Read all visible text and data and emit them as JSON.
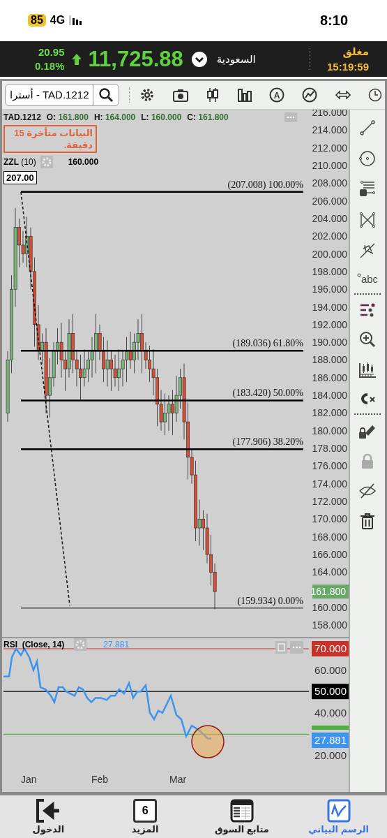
{
  "status_bar": {
    "battery": "85",
    "network": "4G",
    "time": "8:10"
  },
  "ticker": {
    "change": "20.95",
    "change_pct": "0.18%",
    "index_value": "11,725.88",
    "market": "السعودية",
    "market_status": "مغلق",
    "time": "15:19:59"
  },
  "toolbar": {
    "symbol_field": "أسترا - TAD.1212",
    "letter_icon": "A"
  },
  "chart": {
    "symbol": "TAD.1212",
    "ohlc": [
      {
        "label": "O:",
        "value": "161.800"
      },
      {
        "label": "H:",
        "value": "164.000"
      },
      {
        "label": "L:",
        "value": "160.000"
      },
      {
        "label": "C:",
        "value": "161.800"
      }
    ],
    "delay_notice": "البيانات متأخرة 15 دقيقة.",
    "indicator": {
      "name": "ZZL",
      "param": "(10)",
      "value": "160.000"
    },
    "zigzag_high": "207.00",
    "fib_levels": [
      {
        "label": "(207.008) 100.00%"
      },
      {
        "label": "(189.036) 61.80%"
      },
      {
        "label": "(183.420) 50.00%"
      },
      {
        "label": "(177.906) 38.20%"
      },
      {
        "label": "(159.934) 0.00%"
      }
    ],
    "price_axis": [
      "216.000",
      "214.000",
      "212.000",
      "210.000",
      "208.000",
      "206.000",
      "204.000",
      "202.000",
      "200.000",
      "198.000",
      "196.000",
      "194.000",
      "192.000",
      "190.000",
      "188.000",
      "186.000",
      "184.000",
      "182.000",
      "180.000",
      "178.000",
      "176.000",
      "174.000",
      "172.000",
      "170.000",
      "168.000",
      "166.000",
      "164.000",
      "160.000",
      "158.000"
    ],
    "last_price": "161.800"
  },
  "text_tool_label": "abc",
  "rsi": {
    "title": "RSI  (Close, 14)",
    "value": "27.881",
    "axis": [
      {
        "label": "70.000",
        "kind": "badge",
        "color": "#c8302a"
      },
      {
        "label": "60.000",
        "kind": "plain"
      },
      {
        "label": "50.000",
        "kind": "badge",
        "color": "#000000"
      },
      {
        "label": "40.000",
        "kind": "plain"
      },
      {
        "kind": "stripe",
        "color": "#4caf3c"
      },
      {
        "label": "27.881",
        "kind": "badge",
        "color": "#3d93f0"
      },
      {
        "label": "20.000",
        "kind": "plain"
      }
    ]
  },
  "x_axis": [
    "Jan",
    "Feb",
    "Mar"
  ],
  "nav": [
    {
      "label": "الرسم البياني",
      "kind": "chart",
      "selected": true
    },
    {
      "label": "متابع السوق",
      "kind": "table",
      "selected": false
    },
    {
      "label": "المزيد",
      "kind": "badge",
      "badge_text": "6",
      "selected": false
    },
    {
      "label": "الدخول",
      "kind": "login",
      "selected": false
    }
  ]
}
